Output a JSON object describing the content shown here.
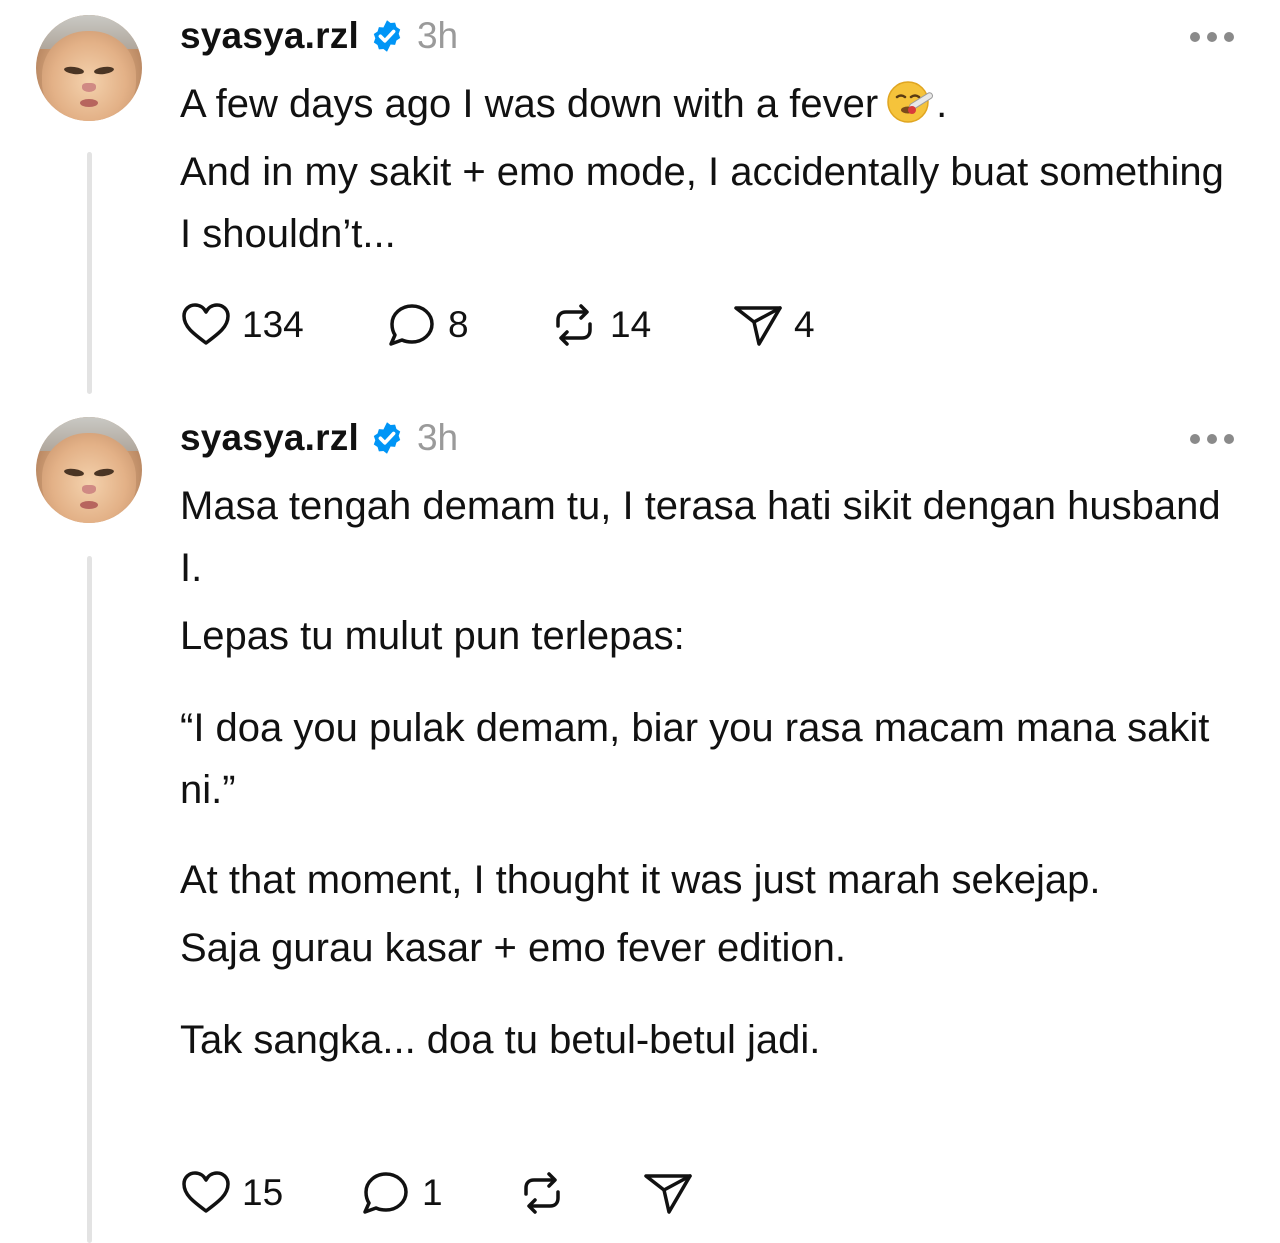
{
  "posts": [
    {
      "username": "syasya.rzl",
      "timestamp": "3h",
      "lines": [
        "A few days ago I was down with a fever",
        "And in my sakit + emo mode, I accidentally buat something I shouldn’t..."
      ],
      "trailing_after_emoji": ".",
      "emoji": "face-with-thermometer-emoji",
      "likes": "134",
      "comments": "8",
      "reposts": "14",
      "shares": "4"
    },
    {
      "username": "syasya.rzl",
      "timestamp": "3h",
      "lines": [
        "Masa tengah demam tu, I terasa hati sikit dengan husband I.",
        "Lepas tu mulut pun terlepas:",
        "“I doa you pulak demam, biar you rasa macam mana sakit ni.”",
        "At that moment, I thought it was just marah sekejap.",
        "Saja gurau kasar + emo fever edition.",
        "Tak sangka... doa tu betul-betul jadi."
      ],
      "likes": "15",
      "comments": "1",
      "reposts": "",
      "shares": ""
    }
  ],
  "icons": {
    "verified": "verified-badge-icon",
    "like": "heart-icon",
    "comment": "comment-bubble-icon",
    "repost": "repost-icon",
    "share": "send-icon",
    "more": "more-dots-icon"
  },
  "colors": {
    "verified_blue": "#0095f6",
    "timestamp_gray": "#9a9a9a",
    "thread_line": "#e3e3e3"
  }
}
